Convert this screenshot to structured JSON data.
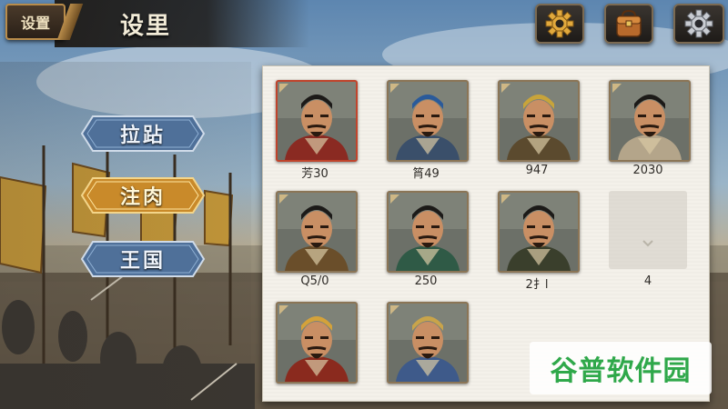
{
  "topbar": {
    "settings_tab": "设置",
    "title": "设里",
    "icons": [
      "gear-icon",
      "bag-icon",
      "gear-icon"
    ]
  },
  "menu": {
    "items": [
      {
        "label": "拉跕",
        "active": false
      },
      {
        "label": "注肉",
        "active": true
      },
      {
        "label": "王国",
        "active": false
      }
    ]
  },
  "heroes": [
    {
      "label": "芳30",
      "selected": true
    },
    {
      "label": "筲49",
      "selected": false
    },
    {
      "label": "947",
      "selected": false
    },
    {
      "label": "2030",
      "selected": false
    },
    {
      "label": "Q5/0",
      "selected": false
    },
    {
      "label": "250",
      "selected": false
    },
    {
      "label": "2扌l",
      "selected": false
    },
    {
      "label": "4",
      "selected": false
    },
    {
      "label": "",
      "selected": false
    },
    {
      "label": "",
      "selected": false
    }
  ],
  "watermark": {
    "text": "谷普软件园"
  },
  "colors": {
    "accent_gold": "#d9a441",
    "button_blue": "#5a7fae",
    "panel_bg": "#f4f1ea",
    "selected_border": "#c0442c"
  }
}
